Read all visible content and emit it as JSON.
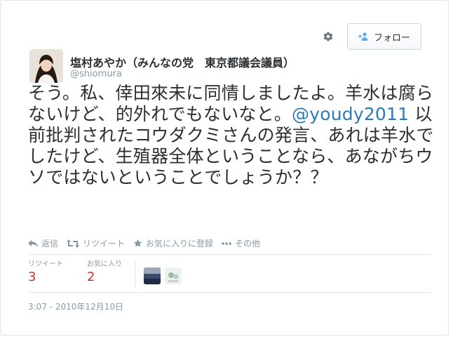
{
  "profile": {
    "name": "塩村あやか（みんなの党　東京都議会議員）",
    "handle": "@shiomura"
  },
  "header": {
    "follow_label": "フォロー",
    "gear_icon": "gear-icon"
  },
  "tweet": {
    "text_before": "そう。私、倖田來未に同情しましたよ。羊水は腐らないけど、的外れでもないなと。",
    "mention": "@youdy2011",
    "text_after": " 以前批判されたコウダクミさんの発言、あれは羊水でしたけど、生殖器全体ということなら、あながちウソではないということでしょうか？？"
  },
  "actions": {
    "reply": "返信",
    "retweet": "リツイート",
    "favorite": "お気に入りに登録",
    "more": "その他"
  },
  "stats": {
    "retweets_label": "リツイート",
    "retweets_value": "3",
    "favorites_label": "お気に入り",
    "favorites_value": "2"
  },
  "timestamp": "3:07 - 2010年12月10日",
  "colors": {
    "mention": "#2b7bb9",
    "count": "#c0392b",
    "muted": "#8899a6"
  }
}
